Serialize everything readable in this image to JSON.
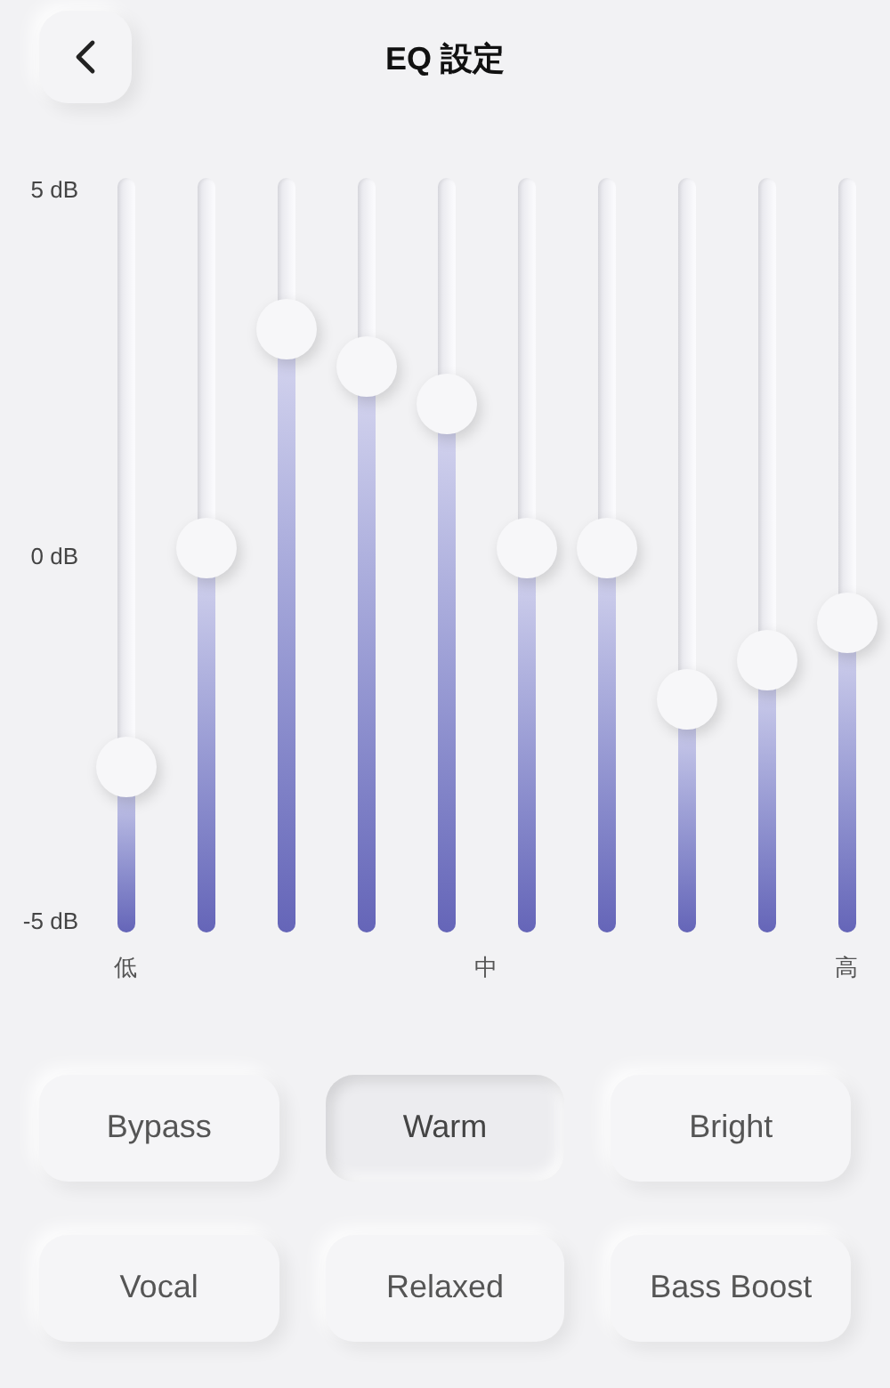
{
  "header": {
    "title": "EQ 設定"
  },
  "eq": {
    "y_labels": [
      "5 dB",
      "0 dB",
      "-5 dB"
    ],
    "bands": [
      {
        "level": 0.22
      },
      {
        "level": 0.51
      },
      {
        "level": 0.8
      },
      {
        "level": 0.75
      },
      {
        "level": 0.7
      },
      {
        "level": 0.51
      },
      {
        "level": 0.51
      },
      {
        "level": 0.31
      },
      {
        "level": 0.36
      },
      {
        "level": 0.41
      }
    ],
    "x_labels": [
      "低",
      "中",
      "高"
    ]
  },
  "presets": [
    {
      "label": "Bypass",
      "selected": false
    },
    {
      "label": "Warm",
      "selected": true
    },
    {
      "label": "Bright",
      "selected": false
    },
    {
      "label": "Vocal",
      "selected": false
    },
    {
      "label": "Relaxed",
      "selected": false
    },
    {
      "label": "Bass Boost",
      "selected": false
    }
  ]
}
